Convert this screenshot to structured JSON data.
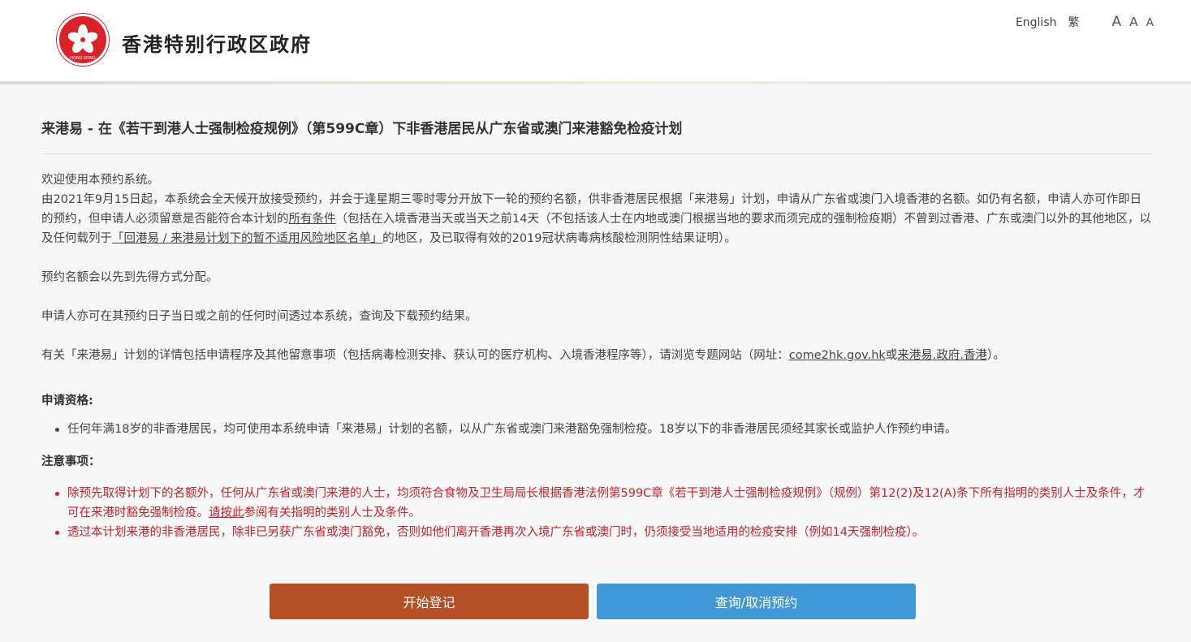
{
  "header": {
    "site_title": "香港特别行政区政府",
    "logo_ring_text": "HONG KONG",
    "lang_english": "English",
    "lang_traditional": "繁",
    "font_size_large": "A",
    "font_size_medium": "A",
    "font_size_small": "A"
  },
  "main": {
    "title": "来港易 - 在《若干到港人士强制检疫规例》（第599C章）下非香港居民从广东省或澳门来港豁免检疫计划",
    "welcome": "欢迎使用本预约系统。",
    "intro": {
      "part1": "由2021年9月15日起，本系统会全天候开放接受预约，并会于逢星期三零时零分开放下一轮的预约名额，供非香港居民根据「来港易」计划，申请从广东省或澳门入境香港的名额。如仍有名额，申请人亦可作即日的预约，但申请人必须留意是否能符合本计划的",
      "link_all_conditions": "所有条件",
      "part2": "（包括在入境香港当天或当天之前14天（不包括该人士在内地或澳门根据当地的要求而须完成的强制检疫期）不曾到过香港、广东或澳门以外的其他地区，以及任何载列于",
      "link_risk_list": "「回港易 / 来港易计划下的暂不适用风险地区名单」",
      "part3": "的地区，及已取得有效的2019冠状病毒病核酸检测阴性结果证明）。"
    },
    "allocation": "预约名额会以先到先得方式分配。",
    "query_info": "申请人亦可在其预约日子当日或之前的任何时间透过本系统，查询及下载预约结果。",
    "details": {
      "part1": "有关「来港易」计划的详情包括申请程序及其他留意事项（包括病毒检测安排、获认可的医疗机构、入境香港程序等），请浏览专题网站（网址：",
      "link1": "come2hk.gov.hk",
      "or": "或",
      "link2": "来港易.政府.香港",
      "part2": "）。"
    },
    "eligibility_heading": "申请资格:",
    "eligibility_items": [
      "任何年满18岁的非香港居民，均可使用本系统申请「来港易」计划的名额，以从广东省或澳门来港豁免强制检疫。18岁以下的非香港居民须经其家长或监护人作预约申请。"
    ],
    "notes_heading": "注意事项：",
    "notes": {
      "item1_part1": "除预先取得计划下的名额外，任何从广东省或澳门来港的人士，均须符合食物及卫生局局长根据香港法例第599C章《若干到港人士强制检疫规例》（规例）第12(2)及12(A)条下所有指明的类别人士及条件，才可在来港时豁免强制检疫。",
      "item1_link": "请按此",
      "item1_part2": "参阅有关指明的类别人士及条件。",
      "item2": "透过本计划来港的非香港居民，除非已另获广东省或澳门豁免，否则如他们离开香港再次入境广东省或澳门时，仍须接受当地适用的检疫安排（例如14天强制检疫）。"
    }
  },
  "buttons": {
    "start_registration": "开始登记",
    "query_cancel": "查询/取消预约"
  },
  "colors": {
    "primary_button": "#b54f25",
    "secondary_button": "#4098d7",
    "notice_red": "#c7212b",
    "emblem_red": "#d8232a"
  }
}
